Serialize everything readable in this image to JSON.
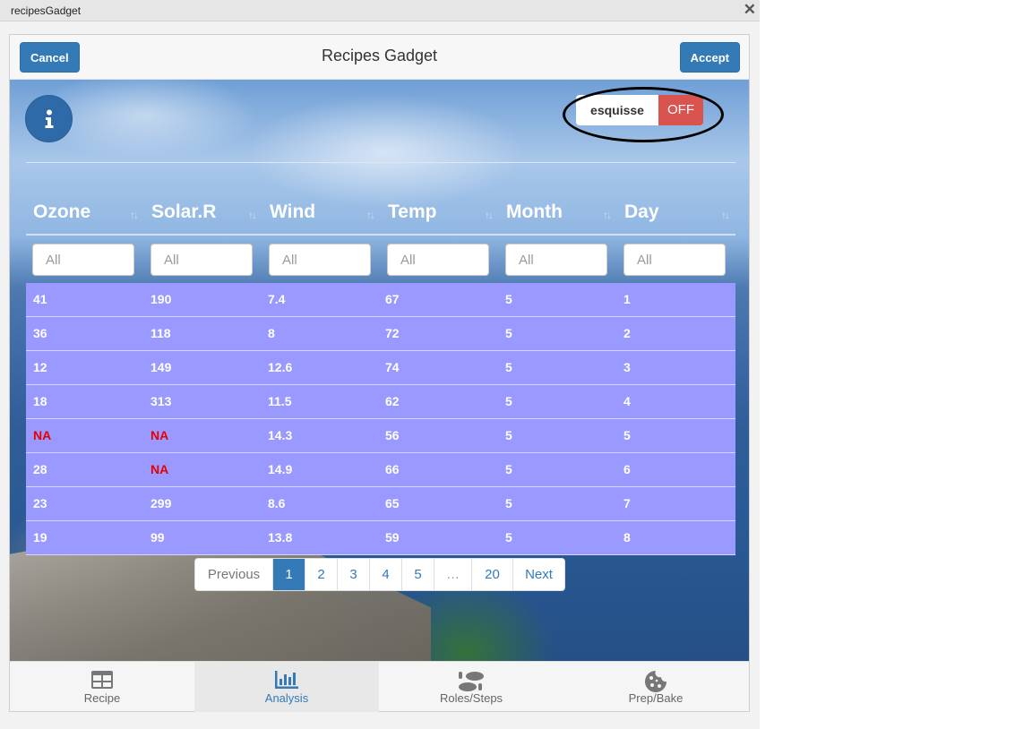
{
  "window": {
    "title": "recipesGadget",
    "close_glyph": "✕"
  },
  "header": {
    "cancel_label": "Cancel",
    "title": "Recipes Gadget",
    "accept_label": "Accept"
  },
  "info_icon": "info-icon",
  "toggle": {
    "label": "esquisse",
    "state": "OFF",
    "state_color": "#d9534f"
  },
  "table": {
    "columns": [
      "Ozone",
      "Solar.R",
      "Wind",
      "Temp",
      "Month",
      "Day"
    ],
    "filter_placeholder": "All",
    "row_color": "#9999ff",
    "na_color": "#e60000",
    "rows": [
      [
        "41",
        "190",
        "7.4",
        "67",
        "5",
        "1"
      ],
      [
        "36",
        "118",
        "8",
        "72",
        "5",
        "2"
      ],
      [
        "12",
        "149",
        "12.6",
        "74",
        "5",
        "3"
      ],
      [
        "18",
        "313",
        "11.5",
        "62",
        "5",
        "4"
      ],
      [
        "NA",
        "NA",
        "14.3",
        "56",
        "5",
        "5"
      ],
      [
        "28",
        "NA",
        "14.9",
        "66",
        "5",
        "6"
      ],
      [
        "23",
        "299",
        "8.6",
        "65",
        "5",
        "7"
      ],
      [
        "19",
        "99",
        "13.8",
        "59",
        "5",
        "8"
      ]
    ]
  },
  "pagination": {
    "previous": "Previous",
    "pages": [
      "1",
      "2",
      "3",
      "4",
      "5",
      "…",
      "20"
    ],
    "active_page": "1",
    "next": "Next"
  },
  "tabs": [
    {
      "label": "Recipe",
      "icon": "table-icon"
    },
    {
      "label": "Analysis",
      "icon": "bar-chart-icon",
      "active": true
    },
    {
      "label": "Roles/Steps",
      "icon": "footsteps-icon"
    },
    {
      "label": "Prep/Bake",
      "icon": "cookie-icon"
    }
  ]
}
